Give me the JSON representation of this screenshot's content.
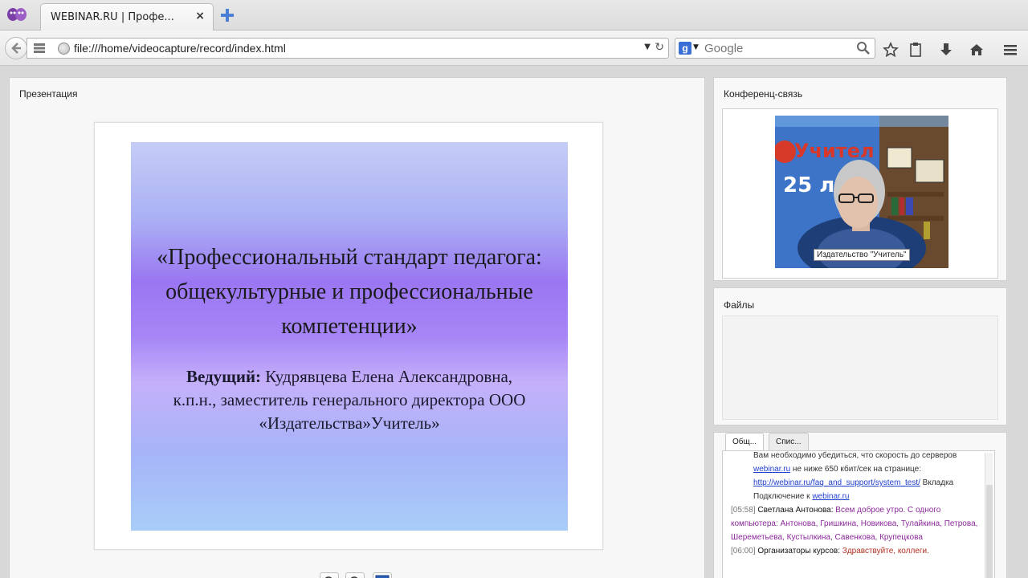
{
  "browser": {
    "tab_title": "WEBINAR.RU | Профе...",
    "tab_close": "×",
    "url": "file:///home/videocapture/record/index.html",
    "search_placeholder": "Google",
    "search_engine_letter": "g"
  },
  "presentation": {
    "panel_title": "Презентация",
    "slide_title": "«Профессиональный стандарт педагога: общекультурные и профессиональные компетенции»",
    "host_label": "Ведущий:",
    "host_text": "Кудрявцева Елена Александровна, к.п.н., заместитель генерального директора ООО «Издательства»Учитель»",
    "colors": {
      "slide_top": "#c4cdf6",
      "slide_mid": "#9a76f2",
      "slide_bottom": "#a8cdf8"
    }
  },
  "conference": {
    "panel_title": "Конференц-связь",
    "video_caption": "Издательство \"Учитель\"",
    "banner_text": "Учител",
    "banner_number": "25 ле"
  },
  "files": {
    "panel_title": "Файлы"
  },
  "chat": {
    "tabs": [
      {
        "label": "Общ..."
      },
      {
        "label": "Спис..."
      }
    ],
    "lines": {
      "l1": "Вам необходимо убедиться, что скорость до серверов",
      "l2_link": "webinar.ru",
      "l2_text": " не ниже 650 кбит/сек на странице:",
      "l3_link": "http://webinar.ru/faq_and_support/system_test/",
      "l3_text": " Вкладка",
      "l4_text": "Подключение к ",
      "l4_link": "webinar.ru",
      "m1_time": "[05:58]",
      "m1_name": " Светлана Антонова: ",
      "m1_msg": "Всем доброе утро. С одного компьютера: Антонова, Гришкина, Новикова, Тулайкина, Петрова, Шереметьева, Кустылкина, Савенкова, Крупецкова",
      "m2_time": "[06:00]",
      "m2_name": " Организаторы курсов: ",
      "m2_msg": "Здравствуйте, коллеги."
    }
  }
}
